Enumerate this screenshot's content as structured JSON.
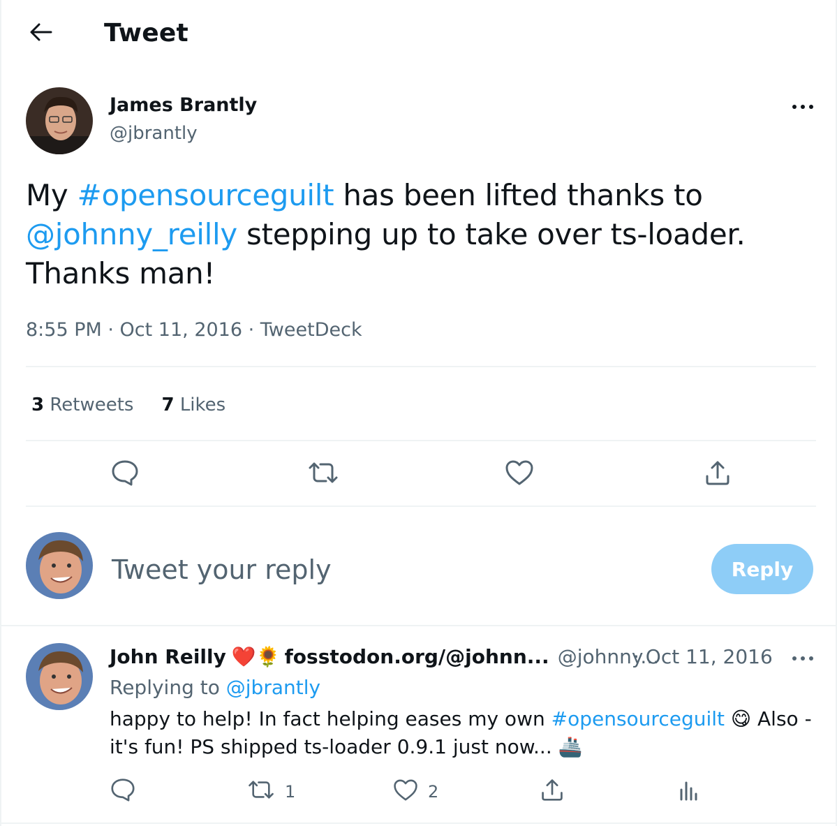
{
  "header": {
    "title": "Tweet"
  },
  "tweet": {
    "author_name": "James Brantly",
    "author_handle": "@jbrantly",
    "text_1": "My ",
    "hashtag": "#opensourceguilt",
    "text_2": " has been lifted thanks to ",
    "mention": "@johnny_reilly",
    "text_3": " stepping up to take over ts-loader. Thanks man!",
    "meta": "8:55 PM · Oct 11, 2016 · TweetDeck",
    "retweet_count": "3",
    "retweet_label": "Retweets",
    "like_count": "7",
    "like_label": "Likes"
  },
  "composer": {
    "placeholder": "Tweet your reply",
    "button_label": "Reply"
  },
  "reply": {
    "author_name": "John Reilly",
    "name_emojis": "❤️🌻",
    "site": "fosstodon.org/@johnn...",
    "handle": "@johnny...",
    "date": "· Oct 11, 2016",
    "replying_prefix": "Replying to ",
    "replying_to": "@jbrantly",
    "text_1": "happy to help! In fact helping eases my own ",
    "hashtag": "#opensourceguilt",
    "emoji_1": "😋",
    "text_2": " Also - it's fun! PS shipped ts-loader 0.9.1 just now... ",
    "emoji_2": "🚢",
    "retweets": "1",
    "likes": "2"
  },
  "icons": {
    "back": "arrow-left-icon",
    "more": "more-dots-icon",
    "reply": "reply-bubble-icon",
    "retweet": "retweet-icon",
    "like": "heart-icon",
    "share": "share-icon",
    "analytics": "analytics-icon"
  },
  "colors": {
    "accent": "#1d9bf0",
    "secondary_text": "#536471",
    "reply_button_disabled": "#8ecdf7",
    "divider": "#eff3f4"
  }
}
